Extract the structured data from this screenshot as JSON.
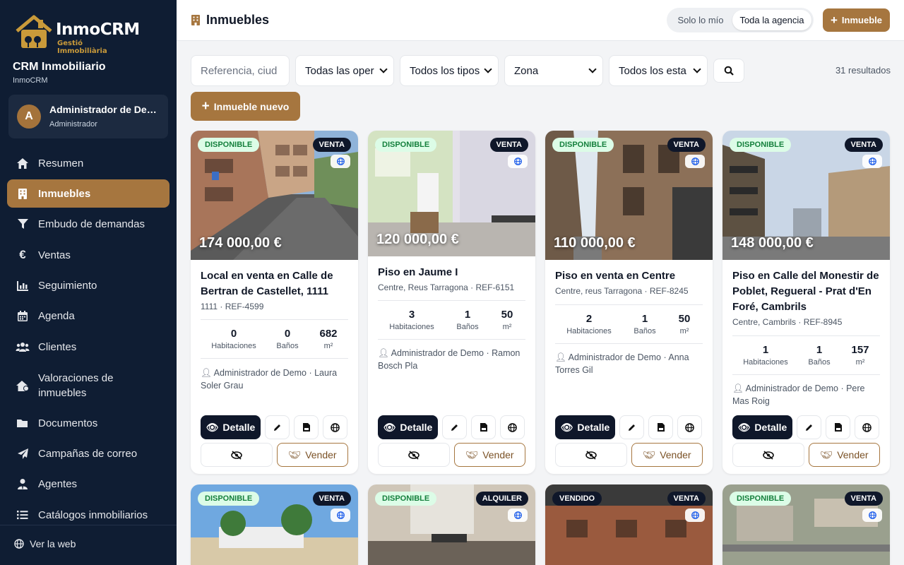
{
  "sidebar": {
    "logo_name": "InmoCRM",
    "logo_tagline": "Gestió Immobiliària",
    "crm_title": "CRM Inmobiliario",
    "crm_subtitle": "InmoCRM",
    "user": {
      "initial": "A",
      "name": "Administrador de Demo",
      "role": "Administrador"
    },
    "nav": [
      {
        "label": "Resumen",
        "icon": "home-icon",
        "active": false
      },
      {
        "label": "Inmuebles",
        "icon": "building-icon",
        "active": true
      },
      {
        "label": "Embudo de demandas",
        "icon": "funnel-icon",
        "active": false
      },
      {
        "label": "Ventas",
        "icon": "euro-icon",
        "active": false
      },
      {
        "label": "Seguimiento",
        "icon": "chart-icon",
        "active": false
      },
      {
        "label": "Agenda",
        "icon": "calendar-icon",
        "active": false
      },
      {
        "label": "Clientes",
        "icon": "users-icon",
        "active": false
      },
      {
        "label": "Valoraciones de inmuebles",
        "icon": "house-value-icon",
        "active": false
      },
      {
        "label": "Documentos",
        "icon": "folder-icon",
        "active": false
      },
      {
        "label": "Campañas de correo",
        "icon": "paper-plane-icon",
        "active": false
      },
      {
        "label": "Agentes",
        "icon": "user-tie-icon",
        "active": false
      },
      {
        "label": "Catálogos inmobiliarios",
        "icon": "list-icon",
        "active": false
      }
    ],
    "web_link": "Ver la web"
  },
  "header": {
    "title": "Inmuebles",
    "toggle": [
      "Solo lo mío",
      "Toda la agencia"
    ],
    "toggle_selected": "Toda la agencia",
    "add_button": "Inmueble"
  },
  "filters": {
    "search_placeholder": "Referencia, ciud",
    "operation": "Todas las oper",
    "type": "Todos los tipos",
    "zone": "Zona",
    "status": "Todos los esta",
    "results": "31 resultados",
    "new_button": "Inmueble nuevo"
  },
  "actions": {
    "detail": "Detalle",
    "sell": "Vender"
  },
  "colors": {
    "sidebar_bg": "#0f1d33",
    "accent": "#a6763f",
    "available_bg": "#dcfce7",
    "available_text": "#15803d",
    "sold_bg": "#0f172a"
  },
  "cards": [
    {
      "status": "DISPONIBLE",
      "operation": "VENTA",
      "price": "174 000,00 €",
      "title": "Local en venta en Calle de Bertran de Castellet, 1111",
      "location": "1111 · REF-4599",
      "rooms": "0",
      "baths": "0",
      "area": "682",
      "rooms_label": "Habitaciones",
      "baths_label": "Baños",
      "area_label": "m²",
      "agents": "Administrador de Demo · Laura Soler Grau"
    },
    {
      "status": "DISPONIBLE",
      "operation": "VENTA",
      "price": "120 000,00 €",
      "title": "Piso en Jaume I",
      "location": "Centre, Reus Tarragona · REF-6151",
      "rooms": "3",
      "baths": "1",
      "area": "50",
      "rooms_label": "Habitaciones",
      "baths_label": "Baños",
      "area_label": "m²",
      "agents": "Administrador de Demo · Ramon Bosch Pla"
    },
    {
      "status": "DISPONIBLE",
      "operation": "VENTA",
      "price": "110 000,00 €",
      "title": "Piso en venta en Centre",
      "location": "Centre, reus Tarragona · REF-8245",
      "rooms": "2",
      "baths": "1",
      "area": "50",
      "rooms_label": "Habitaciones",
      "baths_label": "Baños",
      "area_label": "m²",
      "agents": "Administrador de Demo · Anna Torres Gil"
    },
    {
      "status": "DISPONIBLE",
      "operation": "VENTA",
      "price": "148 000,00 €",
      "title": "Piso en Calle del Monestir de Poblet, Regueral - Prat d'En Foré, Cambrils",
      "location": "Centre, Cambrils · REF-8945",
      "rooms": "1",
      "baths": "1",
      "area": "157",
      "rooms_label": "Habitaciones",
      "baths_label": "Baños",
      "area_label": "m²",
      "agents": "Administrador de Demo · Pere Mas Roig"
    }
  ],
  "bottom_cards": [
    {
      "status": "DISPONIBLE",
      "operation": "VENTA"
    },
    {
      "status": "DISPONIBLE",
      "operation": "ALQUILER"
    },
    {
      "status": "VENDIDO",
      "operation": "VENTA"
    },
    {
      "status": "DISPONIBLE",
      "operation": "VENTA"
    }
  ]
}
